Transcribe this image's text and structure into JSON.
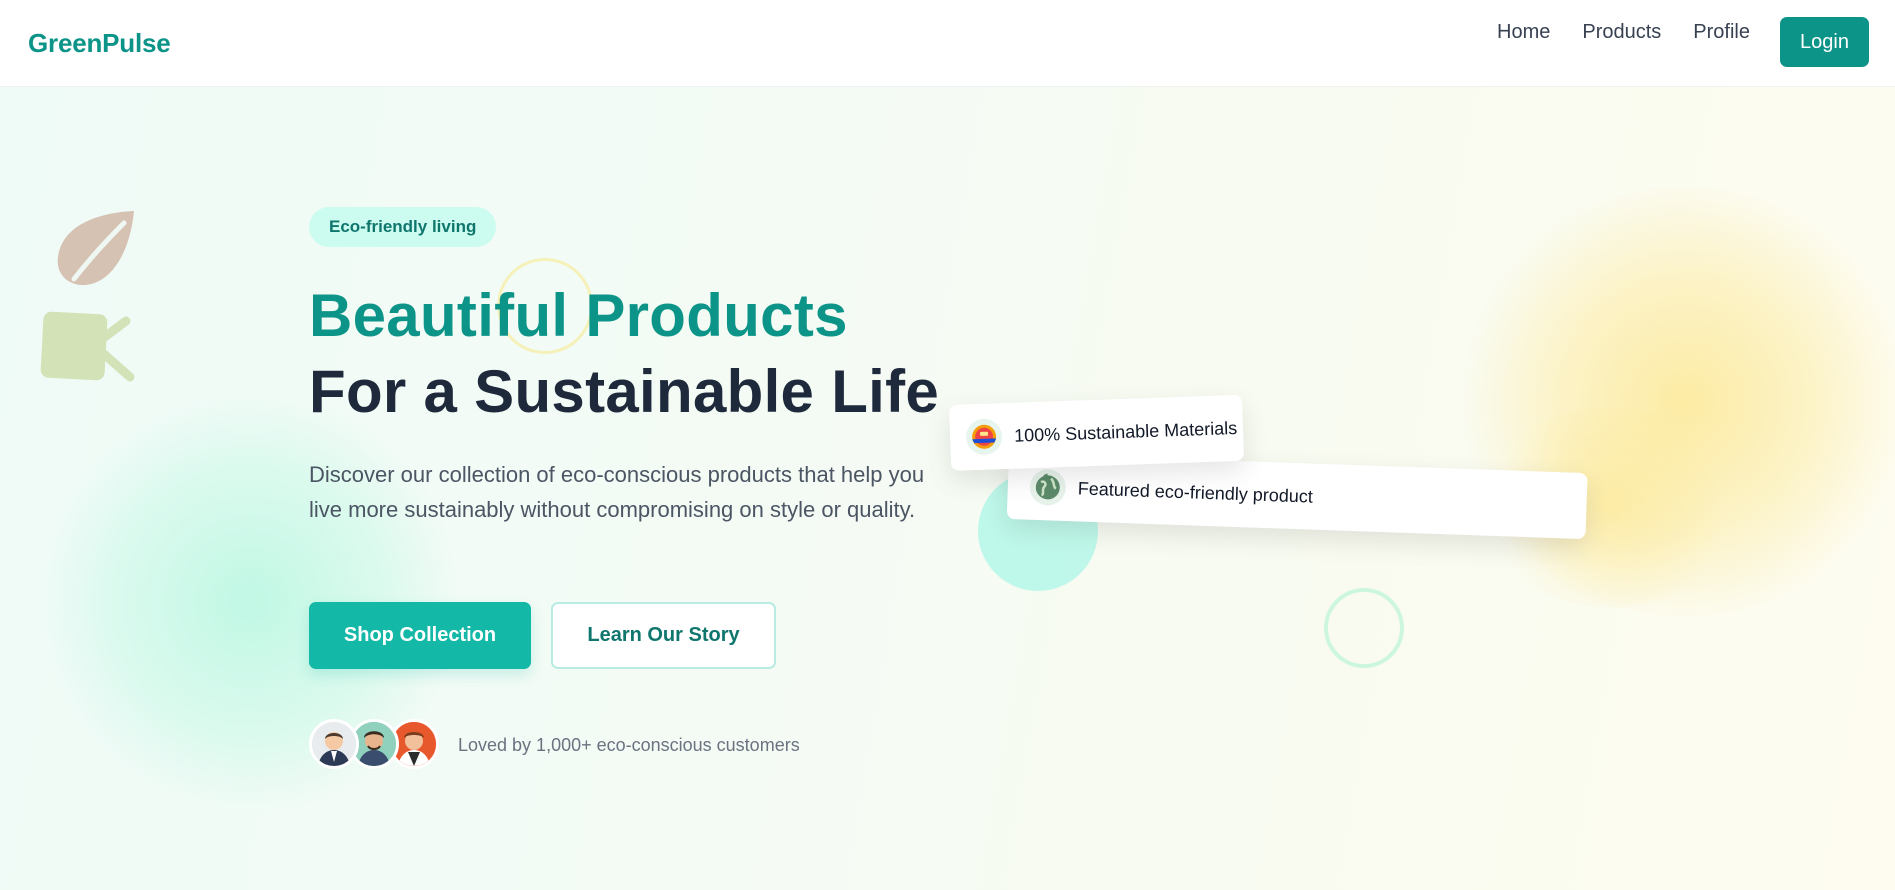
{
  "header": {
    "brand": "GreenPulse",
    "nav": [
      "Home",
      "Products",
      "Profile"
    ],
    "login_label": "Login"
  },
  "hero": {
    "eyebrow": "Eco-friendly living",
    "headline_accent": "Beautiful Products",
    "headline_main": "For a Sustainable Life",
    "description": "Discover our collection of eco-conscious products that help you live more sustainably without compromising on style or quality.",
    "primary_cta": "Shop Collection",
    "secondary_cta": "Learn Our Story",
    "social_proof": "Loved by 1,000+ eco-conscious customers"
  },
  "cards": {
    "featured": "Featured eco-friendly product",
    "materials": "100% Sustainable Materials"
  },
  "colors": {
    "brand": "#0d9488",
    "cta": "#14b8a6",
    "heading": "#1e293b",
    "eyebrow_bg": "#ccfbef"
  },
  "icons": [
    "leaf-icon",
    "note-icon",
    "globe-icon",
    "best-badge-icon"
  ]
}
